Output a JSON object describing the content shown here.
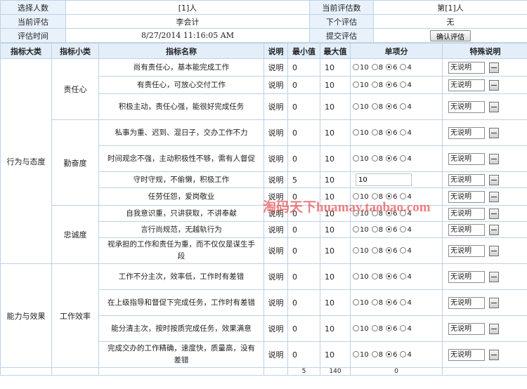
{
  "header": {
    "rows": [
      {
        "label_l": "选择人数",
        "value_l": "[1]人",
        "label_r": "当前评估数",
        "value_r": "第[1]人"
      },
      {
        "label_l": "当前评估",
        "value_l": "李会计",
        "label_r": "下个评估",
        "value_r": "无"
      },
      {
        "label_l": "评估时间",
        "value_l": "8/27/2014 11:16:05 AM",
        "label_r": "提交评估",
        "button": "确认评估"
      }
    ]
  },
  "columns": [
    "指标大类",
    "指标小类",
    "指标名称",
    "说明",
    "最小值",
    "最大值",
    "单项分",
    "特殊说明"
  ],
  "categories": [
    {
      "name": "行为与态度",
      "subs": [
        {
          "name": "责任心",
          "items": [
            {
              "name": "尚有责任心，基本能完成工作",
              "desc": "说明",
              "min": "0",
              "max": "10",
              "selected": "6"
            },
            {
              "name": "有责任心，可放心交付工作",
              "desc": "说明",
              "min": "0",
              "max": "10",
              "selected": "6"
            },
            {
              "name": "积极主动，责任心强，能很好完成任务",
              "desc": "说明",
              "min": "0",
              "max": "10",
              "selected": "6"
            }
          ]
        },
        {
          "name": "勤奋度",
          "items": [
            {
              "name": "私事为重、迟到、混日子，交办工作不力",
              "desc": "说明",
              "min": "0",
              "max": "10",
              "selected": "6"
            },
            {
              "name": "时间观念不强，主动积极性不够，需有人督促",
              "desc": "说明",
              "min": "0",
              "max": "10",
              "selected": "6"
            },
            {
              "name": "守时守规，不偷懒，积极工作",
              "desc": "说明",
              "min": "5",
              "max": "10",
              "input": "10"
            },
            {
              "name": "任劳任怨，爱岗敬业",
              "desc": "说明",
              "min": "0",
              "max": "10",
              "selected": "6"
            }
          ]
        },
        {
          "name": "忠诚度",
          "items": [
            {
              "name": "自我意识重，只讲获取，不讲奉献",
              "desc": "说明",
              "min": "0",
              "max": "10",
              "selected": "6"
            },
            {
              "name": "言行尚规范，无越轨行为",
              "desc": "说明",
              "min": "0",
              "max": "10",
              "selected": "6"
            },
            {
              "name": "视承担的工作和责任为重，而不仅仅是谋生手段",
              "desc": "说明",
              "min": "0",
              "max": "10",
              "selected": "6"
            }
          ]
        }
      ]
    },
    {
      "name": "能力与效果",
      "subs": [
        {
          "name": "工作效率",
          "items": [
            {
              "name": "工作不分主次，效率低，工作时有差错",
              "desc": "说明",
              "min": "0",
              "max": "10",
              "selected": "6"
            },
            {
              "name": "在上级指导和督促下完成任务，工作时有差错",
              "desc": "说明",
              "min": "0",
              "max": "10",
              "selected": "6"
            },
            {
              "name": "能分清主次，按时按质完成任务，效果满意",
              "desc": "说明",
              "min": "0",
              "max": "10",
              "selected": "6"
            },
            {
              "name": "完成交办的工作精确，速度快，质量高，没有差错",
              "desc": "说明",
              "min": "0",
              "max": "10",
              "selected": "6"
            }
          ]
        }
      ]
    }
  ],
  "score_options": [
    "10",
    "8",
    "6",
    "4"
  ],
  "note_value": "无说明",
  "totals": {
    "min": "5",
    "max": "140",
    "score": "0"
  },
  "watermark": "淘码天下huamay.taobao.com"
}
